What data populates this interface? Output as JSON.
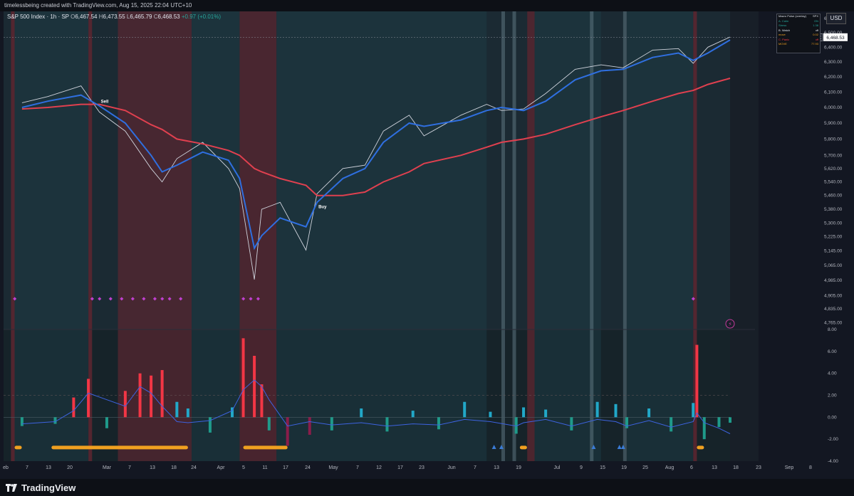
{
  "header": {
    "attribution": "timelessbeing created with TradingView.com, Aug 15, 2025 22:04 UTC+10"
  },
  "legend": {
    "symbol": "S&P 500 Index · 1h · SP",
    "open_label": "O",
    "open": "6,467.54",
    "high_label": "H",
    "high": "6,473.55",
    "low_label": "L",
    "low": "6,465.79",
    "close_label": "C",
    "close": "6,468.53",
    "change": "+0.97 (+0.01%)"
  },
  "currency": "USD",
  "last_price_tag": {
    "ticker": "SPX",
    "price": "6,468.53"
  },
  "macro_panel": {
    "rows": [
      {
        "label": "Macro Pulse (overlay)",
        "value": "SPX"
      },
      {
        "label": "A. Calm",
        "value": "ON"
      },
      {
        "label": "Stress",
        "value": "1.38"
      },
      {
        "label": "B. Watch",
        "value": "off"
      },
      {
        "label": "move",
        "value": "0.02"
      },
      {
        "label": "C. Panic",
        "value": "off"
      },
      {
        "label": "MOVE",
        "value": "77.93"
      }
    ]
  },
  "signals": {
    "sell": "Sell",
    "buy": "Buy"
  },
  "x_labels": [
    "eb",
    "7",
    "13",
    "20",
    "Mar",
    "7",
    "13",
    "18",
    "24",
    "Apr",
    "5",
    "11",
    "17",
    "24",
    "May",
    "7",
    "12",
    "17",
    "23",
    "Jun",
    "7",
    "13",
    "19",
    "Jul",
    "9",
    "15",
    "19",
    "25",
    "Aug",
    "6",
    "13",
    "18",
    "23",
    "Sep",
    "8"
  ],
  "brand": "TradingView",
  "colors": {
    "background": "#1b2a33",
    "up_bar": "#26a9c7",
    "down_bar": "#1f9a8a",
    "sma_fast": "#2f6fe0",
    "sma_slow": "#e0404f",
    "stress_band": "#5a2630",
    "calm_band": "#1e3a44",
    "oscillator_line": "#3d63e0",
    "hist_red": "#f23645",
    "hist_maroon": "#8a1d4a",
    "hist_teal": "#1f9a8a",
    "hist_cyan": "#22a8c8"
  },
  "chart_data": [
    {
      "type": "line",
      "name_in_legend": "S&P 500 Index · 1h · SP",
      "x_axis": "date (2025)",
      "y_axis_ticks": [
        "6,600.00",
        "6,500.00",
        "6,400.00",
        "6,300.00",
        "6,200.00",
        "6,100.00",
        "6,000.00",
        "5,900.00",
        "5,800.00",
        "5,700.00",
        "5,620.00",
        "5,540.00",
        "5,460.00",
        "5,380.00",
        "5,300.00",
        "5,225.00",
        "5,145.00",
        "5,065.00",
        "4,985.00",
        "4,905.00",
        "4,835.00",
        "4,765.00"
      ],
      "ylim": [
        4730,
        6650
      ],
      "dates": [
        "2025-02-03",
        "2025-02-10",
        "2025-02-19",
        "2025-02-24",
        "2025-03-03",
        "2025-03-10",
        "2025-03-13",
        "2025-03-17",
        "2025-03-24",
        "2025-03-31",
        "2025-04-03",
        "2025-04-07",
        "2025-04-09",
        "2025-04-14",
        "2025-04-21",
        "2025-04-24",
        "2025-05-01",
        "2025-05-07",
        "2025-05-12",
        "2025-05-19",
        "2025-05-23",
        "2025-06-02",
        "2025-06-09",
        "2025-06-13",
        "2025-06-19",
        "2025-06-25",
        "2025-07-03",
        "2025-07-10",
        "2025-07-16",
        "2025-07-24",
        "2025-07-31",
        "2025-08-04",
        "2025-08-08",
        "2025-08-14"
      ],
      "price": [
        6030,
        6070,
        6140,
        5970,
        5850,
        5620,
        5540,
        5680,
        5780,
        5620,
        5500,
        4990,
        5380,
        5420,
        5150,
        5470,
        5620,
        5640,
        5850,
        5950,
        5820,
        5950,
        6020,
        5980,
        5990,
        6090,
        6250,
        6280,
        6260,
        6380,
        6390,
        6290,
        6400,
        6470
      ],
      "sma_fast": [
        6000,
        6040,
        6080,
        6010,
        5900,
        5700,
        5600,
        5640,
        5720,
        5670,
        5560,
        5160,
        5230,
        5330,
        5280,
        5420,
        5560,
        5620,
        5780,
        5900,
        5880,
        5920,
        5980,
        6000,
        5980,
        6040,
        6180,
        6240,
        6250,
        6330,
        6360,
        6310,
        6360,
        6450
      ],
      "sma_slow": [
        5990,
        6000,
        6020,
        6020,
        5980,
        5890,
        5860,
        5800,
        5770,
        5730,
        5700,
        5620,
        5600,
        5560,
        5520,
        5460,
        5460,
        5480,
        5540,
        5600,
        5650,
        5700,
        5750,
        5780,
        5800,
        5830,
        5890,
        5940,
        5980,
        6040,
        6090,
        6110,
        6150,
        6190
      ],
      "series_colors": {
        "price": "#cfd3dc",
        "sma_fast": "#2f6fe0",
        "sma_slow": "#e0404f"
      },
      "annotations": [
        {
          "text": "Sell",
          "date": "2025-02-24",
          "value": 6020
        },
        {
          "text": "Buy",
          "date": "2025-04-24",
          "value": 5420
        }
      ],
      "last_price": 6468.53
    },
    {
      "type": "bar",
      "y_axis_ticks": [
        "8.00",
        "6.00",
        "4.00",
        "2.00",
        "0.00",
        "-2.00",
        "-4.00"
      ],
      "ylim": [
        -4,
        8
      ],
      "dates": [
        "2025-02-03",
        "2025-02-12",
        "2025-02-17",
        "2025-02-21",
        "2025-02-26",
        "2025-03-03",
        "2025-03-07",
        "2025-03-10",
        "2025-03-13",
        "2025-03-17",
        "2025-03-20",
        "2025-03-26",
        "2025-04-01",
        "2025-04-04",
        "2025-04-07",
        "2025-04-09",
        "2025-04-11",
        "2025-04-16",
        "2025-04-22",
        "2025-04-28",
        "2025-05-06",
        "2025-05-13",
        "2025-05-20",
        "2025-05-27",
        "2025-06-03",
        "2025-06-10",
        "2025-06-17",
        "2025-06-19",
        "2025-06-25",
        "2025-07-02",
        "2025-07-09",
        "2025-07-14",
        "2025-07-17",
        "2025-07-23",
        "2025-07-29",
        "2025-08-04",
        "2025-08-05",
        "2025-08-07",
        "2025-08-11",
        "2025-08-14"
      ],
      "values": [
        -0.8,
        -0.6,
        1.8,
        3.5,
        -1.0,
        2.4,
        4.0,
        3.8,
        4.3,
        1.4,
        0.8,
        -1.4,
        0.9,
        7.2,
        5.6,
        3.0,
        -1.2,
        -2.6,
        -1.6,
        -1.2,
        0.8,
        -1.3,
        0.6,
        -1.1,
        1.4,
        0.5,
        -1.5,
        0.9,
        0.7,
        -1.2,
        1.4,
        1.2,
        -1.0,
        0.8,
        -1.3,
        1.3,
        6.6,
        -2.0,
        -0.9,
        -0.5
      ],
      "oscillator": [
        -0.6,
        -0.4,
        0.6,
        2.2,
        1.6,
        1.0,
        2.8,
        2.2,
        1.0,
        -0.4,
        -0.5,
        -0.3,
        0.6,
        2.5,
        3.4,
        2.8,
        1.6,
        -0.8,
        -0.4,
        -0.7,
        -0.5,
        -0.8,
        -0.6,
        -0.7,
        -0.2,
        -0.4,
        -0.8,
        -0.5,
        -0.2,
        -0.8,
        -0.2,
        -0.4,
        -0.8,
        -0.3,
        -0.9,
        -0.4,
        0.4,
        -0.5,
        -1.0,
        -1.5
      ],
      "reference_lines": [
        0,
        2
      ]
    }
  ]
}
